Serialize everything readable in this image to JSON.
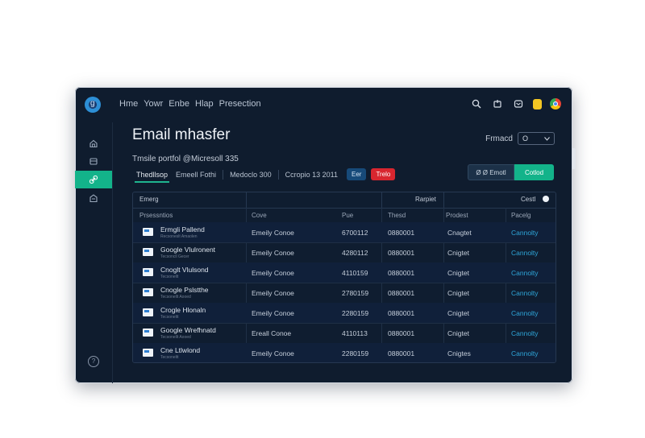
{
  "header": {
    "nav": [
      "Hme",
      "Yowr",
      "Enbe",
      "Hlap",
      "Presection"
    ]
  },
  "page": {
    "title": "Email mhasfer",
    "subtitle": "Tmsile portfol @Micresoll 335",
    "filter_label": "Frmacd",
    "filter_value": "O"
  },
  "tabs": [
    "Thedllsop",
    "Emeell Fothi",
    "Medoclo 300",
    "Ccropio 13 2011"
  ],
  "chips": [
    "Eer",
    "Trelo"
  ],
  "actions": {
    "secondary": "Ø Ø Emotl",
    "primary": "Cotlod"
  },
  "table": {
    "top_labels": {
      "left": "Emerg",
      "group": "Rarpiet",
      "col": "Cestl"
    },
    "headers": [
      "Prsessntios",
      "Cove",
      "Pue",
      "Thesd",
      "Prodest",
      "Pacelg"
    ],
    "rows": [
      {
        "name": "Ermgli Pallend",
        "sub": "Recsoneslt Amaolen",
        "type": "Emeily Conoe",
        "num": "6700112",
        "code": "0880001",
        "status": "Cnagtet",
        "action": "Cannolty"
      },
      {
        "name": "Google Vlulronent",
        "sub": "Tecsoncll Gecer",
        "type": "Emeily Conoe",
        "num": "4280112",
        "code": "0880001",
        "status": "Cnigtet",
        "action": "Cannolty"
      },
      {
        "name": "Cnoglt Vlulsond",
        "sub": "Tecsonellt",
        "type": "Emeily Conoe",
        "num": "4110159",
        "code": "0880001",
        "status": "Cnigtet",
        "action": "Cannolty"
      },
      {
        "name": "Cnogle Pslstthe",
        "sub": "Tecsonellt Aooed",
        "type": "Emeily Conoe",
        "num": "2780159",
        "code": "0880001",
        "status": "Cnigtet",
        "action": "Cannolty"
      },
      {
        "name": "Crogle Hlonaln",
        "sub": "Tecsoneltt",
        "type": "Emeily Conoe",
        "num": "2280159",
        "code": "0880001",
        "status": "Cnigtet",
        "action": "Cannolty"
      },
      {
        "name": "Google Wrefhnatd",
        "sub": "Tecsonellt Aooed",
        "type": "Ereall Conoe",
        "num": "4110113",
        "code": "0880001",
        "status": "Cnigtet",
        "action": "Cannolty"
      },
      {
        "name": "Cne Ltlwlond",
        "sub": "Tecsoneltt",
        "type": "Emeily Conoe",
        "num": "2280159",
        "code": "0880001",
        "status": "Cnigtes",
        "action": "Cannolty"
      }
    ]
  },
  "colors": {
    "window_bg": "#0f1c2e",
    "accent_green": "#13b38a",
    "link_blue": "#2ea5d8",
    "chip_red": "#d8262f"
  }
}
